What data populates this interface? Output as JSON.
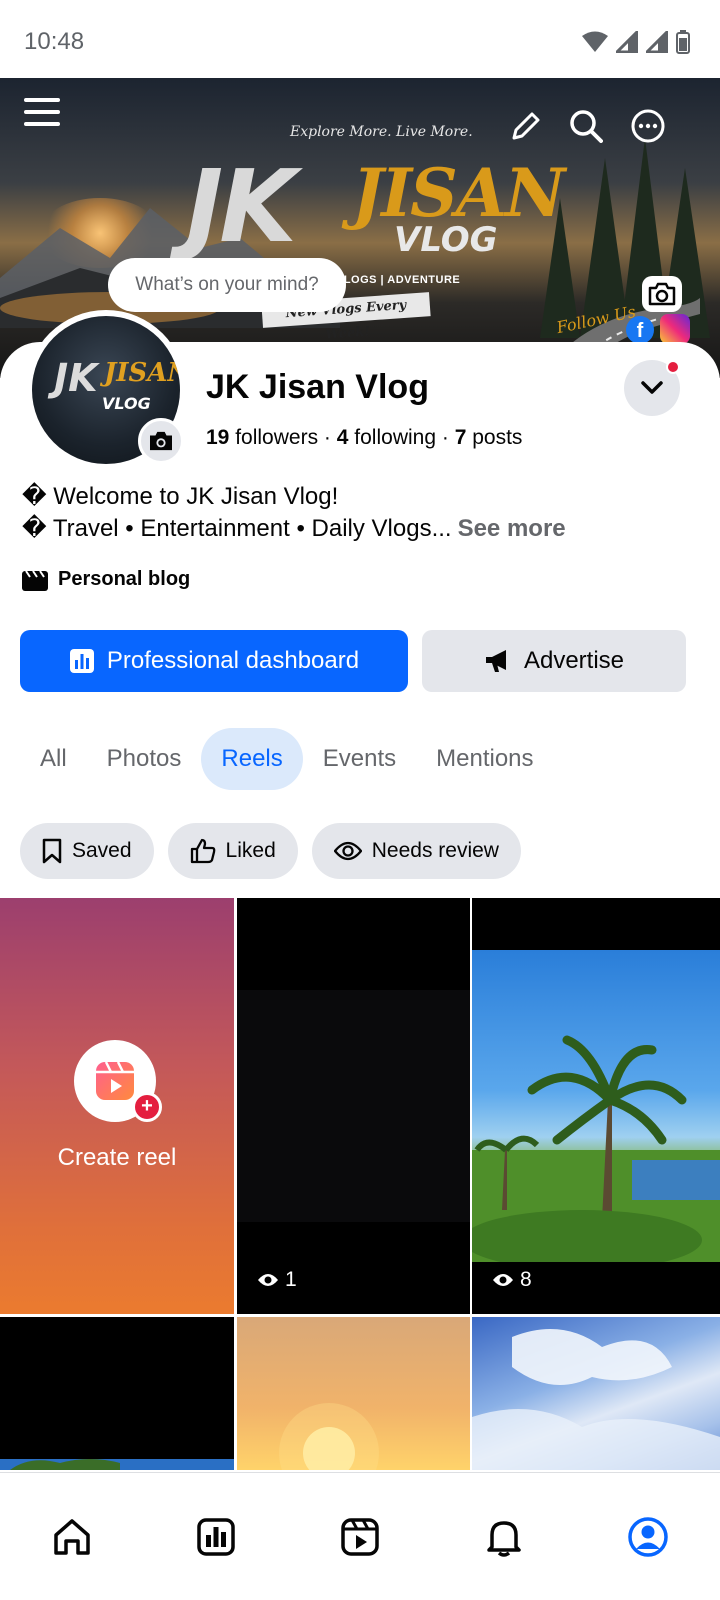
{
  "status_bar": {
    "time": "10:48"
  },
  "cover": {
    "tagline": "Explore More. Live More.",
    "title_part1": "JK",
    "title_part2": "JISAN",
    "title_part3": "VLOG",
    "categories": "VLOGS | ADVENTURE",
    "banner": "New Vlogs Every Week!",
    "follow": "Follow Us"
  },
  "composer": {
    "prompt": "What’s on your mind?"
  },
  "avatar": {
    "line1": "JK",
    "line2": "JISAN",
    "line3": "VLOG"
  },
  "profile": {
    "name": "JK Jisan Vlog",
    "followers_count": "19",
    "followers_label": "followers",
    "following_count": "4",
    "following_label": "following",
    "posts_count": "7",
    "posts_label": "posts",
    "separator": "·",
    "bio_line1": "� Welcome to JK Jisan Vlog!",
    "bio_line2": "� Travel • Entertainment • Daily Vlogs...",
    "see_more": "See more",
    "category": "Personal blog"
  },
  "actions": {
    "primary": "Professional dashboard",
    "secondary": "Advertise"
  },
  "tabs": [
    {
      "label": "All",
      "active": false
    },
    {
      "label": "Photos",
      "active": false
    },
    {
      "label": "Reels",
      "active": true
    },
    {
      "label": "Events",
      "active": false
    },
    {
      "label": "Mentions",
      "active": false
    }
  ],
  "filters": [
    {
      "label": "Saved",
      "icon": "bookmark-icon"
    },
    {
      "label": "Liked",
      "icon": "thumbs-up-icon"
    },
    {
      "label": "Needs review",
      "icon": "eye-icon"
    }
  ],
  "reels": {
    "create_label": "Create reel",
    "items": [
      {
        "views": "1"
      },
      {
        "views": "8"
      }
    ]
  },
  "bottom_nav": [
    {
      "name": "home",
      "icon": "home-icon"
    },
    {
      "name": "dashboard",
      "icon": "dashboard-icon"
    },
    {
      "name": "reels",
      "icon": "reels-icon"
    },
    {
      "name": "notifications",
      "icon": "bell-icon"
    },
    {
      "name": "profile",
      "icon": "profile-icon",
      "active": true
    }
  ],
  "colors": {
    "accent": "#0866ff",
    "button_gray": "#e4e6eb",
    "text_secondary": "#65676b",
    "notification_red": "#e41e3f"
  }
}
